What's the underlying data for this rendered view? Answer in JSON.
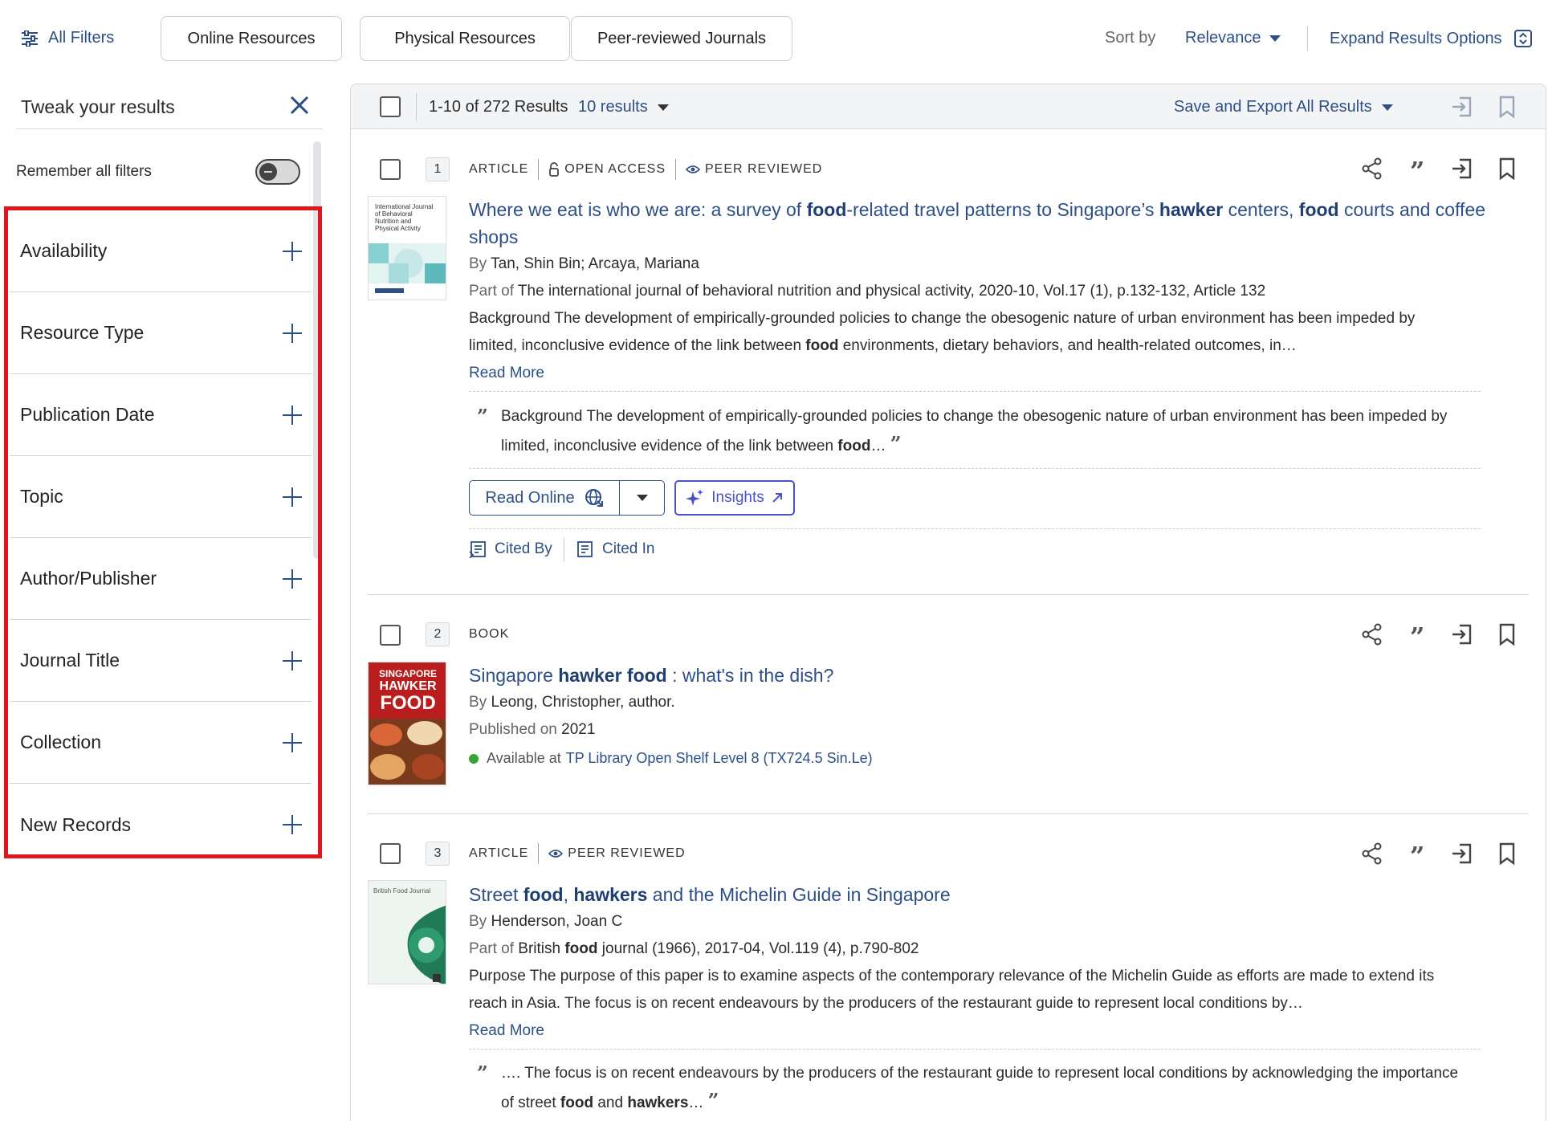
{
  "topbar": {
    "all_filters": "All Filters",
    "chips": [
      "Online Resources",
      "Physical Resources",
      "Peer-reviewed Journals"
    ],
    "sort_by_label": "Sort by",
    "sort_value": "Relevance",
    "expand_label": "Expand Results Options"
  },
  "sidebar": {
    "title": "Tweak your results",
    "remember_label": "Remember all filters",
    "remember_on": false,
    "facets": [
      "Availability",
      "Resource Type",
      "Publication Date",
      "Topic",
      "Author/Publisher",
      "Journal Title",
      "Collection",
      "New Records"
    ]
  },
  "results_header": {
    "count": "1-10 of 272 Results",
    "per_page": "10 results",
    "save_export": "Save and Export All Results"
  },
  "records": [
    {
      "number": "1",
      "type": "ARTICLE",
      "flags": [
        "OPEN ACCESS",
        "PEER REVIEWED"
      ],
      "title_parts": [
        "Where we eat is who we are: a survey of ",
        "food",
        "-related travel patterns to Singapore’s ",
        "hawker",
        " centers, ",
        "food",
        " courts and coffee shops"
      ],
      "by_label": "By",
      "authors": "Tan, Shin Bin; Arcaya, Mariana",
      "part_of_label": "Part of",
      "source": "The international journal of behavioral nutrition and physical activity, 2020-10, Vol.17 (1), p.132-132, Article 132",
      "snippet_a": "Background The development of empirically-grounded policies to change the obesogenic nature of urban environment has been impeded by limited, inconclusive evidence of the link between ",
      "snippet_hl": "food",
      "snippet_b": " environments, dietary behaviors, and health-related outcomes, in…",
      "read_more": "Read More",
      "quote_a": "Background The development of empirically-grounded policies to change the obesogenic nature of urban environment has been impeded by limited, inconclusive evidence of the link between ",
      "quote_hl": "food",
      "quote_b": "…",
      "read_online": "Read Online",
      "insights": "Insights",
      "cited_by": "Cited By",
      "cited_in": "Cited In",
      "cover_lines": [
        "International Journal",
        "of Behavioral",
        "Nutrition and",
        "Physical Activity"
      ]
    },
    {
      "number": "2",
      "type": "BOOK",
      "title_parts": [
        "Singapore ",
        "hawker",
        " ",
        "food",
        " : what's in the dish?"
      ],
      "by_label": "By",
      "authors": "Leong, Christopher, author.",
      "published_label": "Published on",
      "published": "2021",
      "available_label": "Available at",
      "location": "TP Library Open Shelf Level 8 (TX724.5 Sin.Le)",
      "cover_lines": [
        "SINGAPORE",
        "HAWKER",
        "FOOD"
      ]
    },
    {
      "number": "3",
      "type": "ARTICLE",
      "flags": [
        "PEER REVIEWED"
      ],
      "title_parts": [
        "Street ",
        "food",
        ", ",
        "hawkers",
        " and the Michelin Guide in Singapore"
      ],
      "by_label": "By",
      "authors": "Henderson, Joan C",
      "part_of_label": "Part of",
      "source_a": "British ",
      "source_hl": "food",
      "source_b": " journal (1966), 2017-04, Vol.119 (4), p.790-802",
      "snippet": "Purpose The purpose of this paper is to examine aspects of the contemporary relevance of the Michelin Guide as efforts are made to extend its reach in Asia. The focus is on recent endeavours by the producers of the restaurant guide to represent local conditions by…",
      "read_more": "Read More",
      "quote_a": "…. The focus is on recent endeavours by the producers of the restaurant guide to represent local conditions by acknowledging the importance of street ",
      "quote_hl1": "food",
      "quote_mid": " and ",
      "quote_hl2": "hawkers",
      "quote_b": "…",
      "cover_lines": [
        "British Food Journal"
      ]
    }
  ],
  "colors": {
    "link": "#2e4f86",
    "highlight_box": "#e0161c",
    "insights": "#4b51c9",
    "available_dot": "#34a434"
  }
}
